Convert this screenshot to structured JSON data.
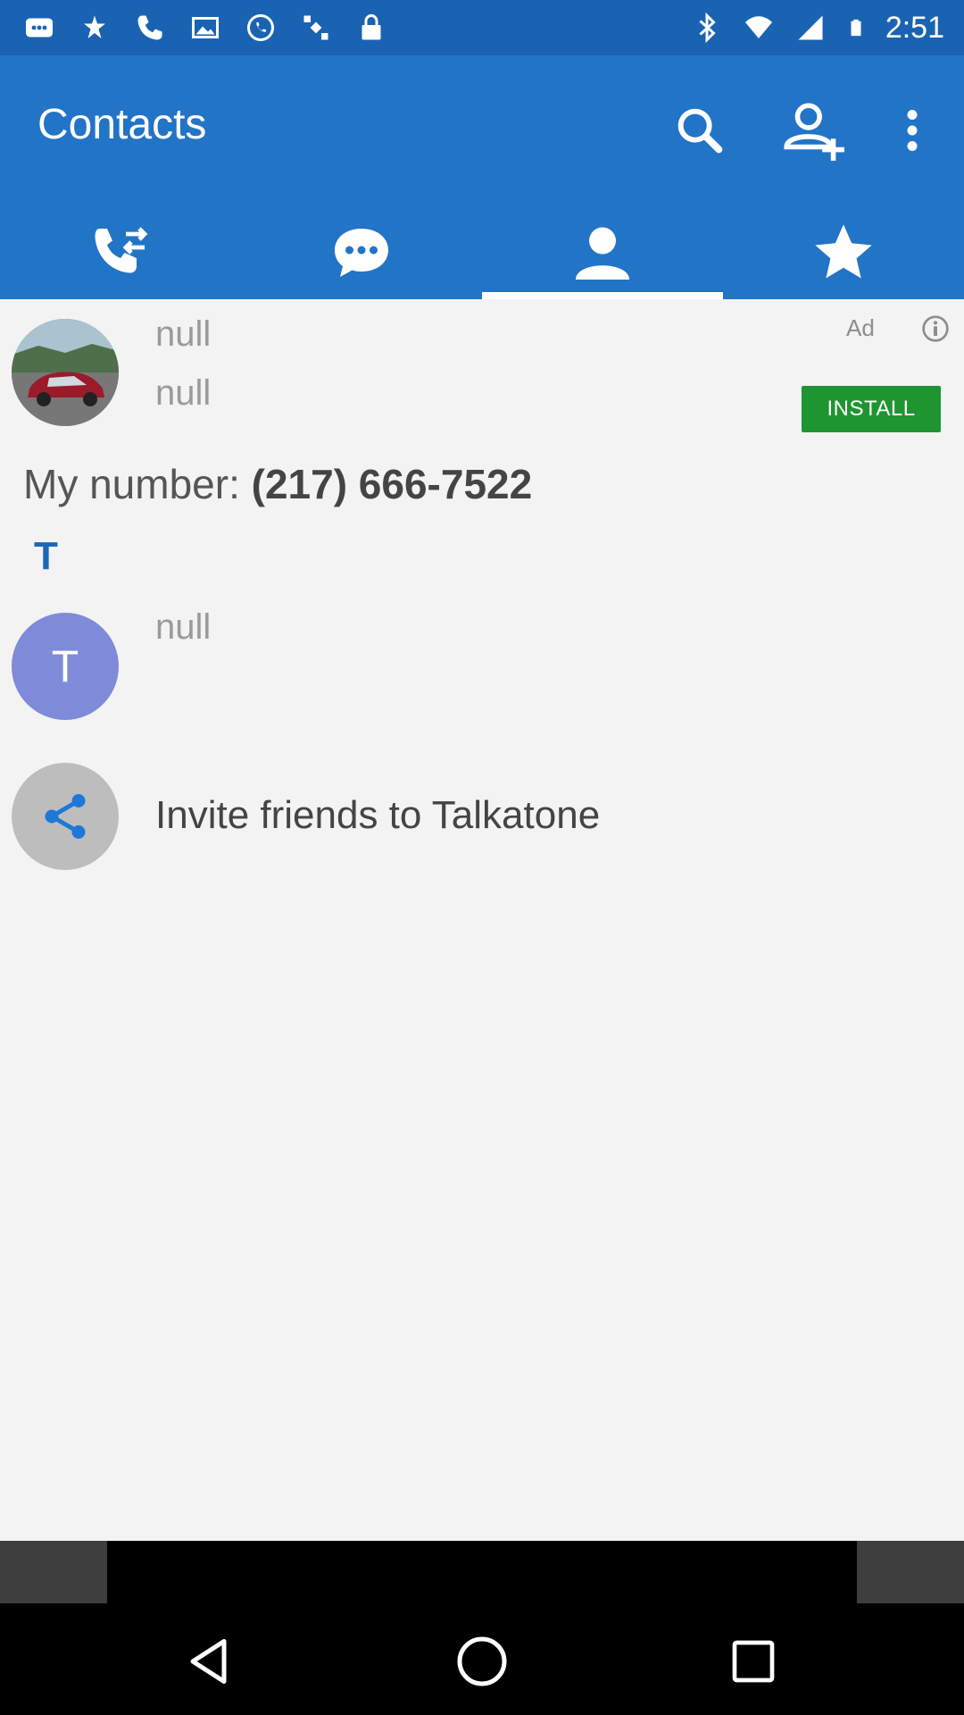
{
  "status_bar": {
    "time": "2:51",
    "left_icons": [
      "messenger-icon",
      "flower-icon",
      "phone-icon",
      "image-icon",
      "whatsapp-icon",
      "satellite-icon",
      "lock-icon"
    ],
    "right_icons": [
      "bluetooth-icon",
      "wifi-icon",
      "signal-icon",
      "battery-icon"
    ]
  },
  "app_bar": {
    "title": "Contacts",
    "actions": [
      "search-icon",
      "add-contact-icon",
      "more-vert-icon"
    ]
  },
  "tabs": [
    {
      "name": "calls",
      "icon": "phone-swap-icon",
      "selected": false
    },
    {
      "name": "messages",
      "icon": "chat-icon",
      "selected": false
    },
    {
      "name": "contacts",
      "icon": "person-icon",
      "selected": true
    },
    {
      "name": "favorites",
      "icon": "star-icon",
      "selected": false
    }
  ],
  "ad": {
    "title": "null",
    "subtitle": "null",
    "ad_label": "Ad",
    "install_label": "INSTALL"
  },
  "my_number": {
    "label": "My number: ",
    "value": "(217) 666-7522"
  },
  "section": {
    "letter": "T"
  },
  "contacts": [
    {
      "initial": "T",
      "name": "null"
    }
  ],
  "invite": {
    "text": "Invite friends to Talkatone"
  },
  "colors": {
    "status_bar": "#1a63b3",
    "app_bar": "#2274c7",
    "install": "#1f9531",
    "avatar_t": "#7f8ad9",
    "section_letter": "#1e66b6"
  }
}
